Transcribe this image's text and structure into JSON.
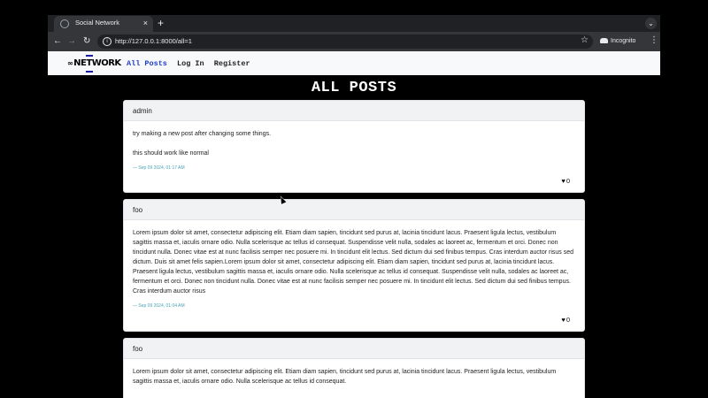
{
  "browser": {
    "tab_title": "Social Network",
    "tab_close": "×",
    "new_tab": "+",
    "tab_search": "⌄",
    "back": "←",
    "forward": "→",
    "reload": "↻",
    "url": "http://127.0.0.1:8000/all=1",
    "site_info": "i",
    "bookmark": "☆",
    "incognito_label": "Incognito",
    "menu": "⋮"
  },
  "site": {
    "brand": "NETWORK",
    "brand_icon": "link-icon",
    "nav": [
      {
        "label": "All Posts",
        "active": true
      },
      {
        "label": "Log In",
        "active": false
      },
      {
        "label": "Register",
        "active": false
      }
    ]
  },
  "page": {
    "heading": "ALL POSTS"
  },
  "posts": [
    {
      "author": "admin",
      "paragraphs": [
        "try making a new post after changing some things.",
        "this should work like normal"
      ],
      "timestamp": "— Sep 09 2024, 01:17 AM",
      "likes": "0"
    },
    {
      "author": "foo",
      "paragraphs": [
        "Lorem ipsum dolor sit amet, consectetur adipiscing elit. Etiam diam sapien, tincidunt sed purus at, lacinia tincidunt lacus. Praesent ligula lectus, vestibulum sagittis massa et, iaculis ornare odio. Nulla scelerisque ac tellus id consequat. Suspendisse velit nulla, sodales ac laoreet ac, fermentum et orci. Donec non tincidunt nulla. Donec vitae est at nunc facilisis semper nec posuere mi. In tincidunt elit lectus. Sed dictum dui sed finibus tempus. Cras interdum auctor risus sed dictum. Duis sit amet felis sapien.Lorem ipsum dolor sit amet, consectetur adipiscing elit. Etiam diam sapien, tincidunt sed purus at, lacinia tincidunt lacus. Praesent ligula lectus, vestibulum sagittis massa et, iaculis ornare odio. Nulla scelerisque ac tellus id consequat. Suspendisse velit nulla, sodales ac laoreet ac, fermentum et orci. Donec non tincidunt nulla. Donec vitae est at nunc facilisis semper nec posuere mi. In tincidunt elit lectus. Sed dictum dui sed finibus tempus. Cras interdum auctor risus"
      ],
      "timestamp": "— Sep 09 2024, 01:04 AM",
      "likes": "0"
    },
    {
      "author": "foo",
      "paragraphs": [
        "Lorem ipsum dolor sit amet, consectetur adipiscing elit. Etiam diam sapien, tincidunt sed purus at, lacinia tincidunt lacus. Praesent ligula lectus, vestibulum sagittis massa et, iaculis ornare odio. Nulla scelerisque ac tellus id consequat."
      ],
      "timestamp": "",
      "likes": ""
    }
  ]
}
